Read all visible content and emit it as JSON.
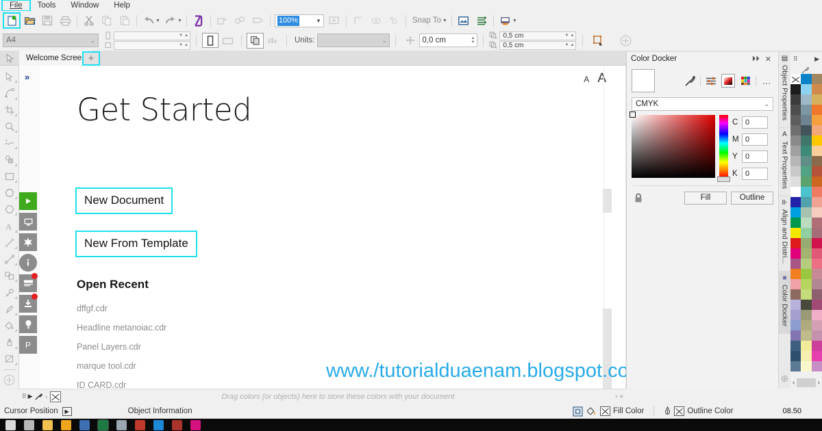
{
  "menubar": {
    "items": [
      {
        "label": "File",
        "selected": true
      },
      {
        "label": "Tools",
        "selected": false
      },
      {
        "label": "Window",
        "selected": false
      },
      {
        "label": "Help",
        "selected": false
      }
    ]
  },
  "toolbar": {
    "new_icon": "new-document-icon",
    "open_icon": "open-folder-icon",
    "save_icon": "save-icon",
    "print_icon": "print-icon",
    "cut_icon": "scissors-icon",
    "copy_icon": "copy-icon",
    "paste_icon": "paste-icon",
    "undo_icon": "undo-icon",
    "redo_icon": "redo-icon",
    "import_icon": "import-icon",
    "export_icon": "export-icon",
    "publish_pdf_icon": "publish-pdf-icon",
    "zoom_value": "100%",
    "fullscreen_icon": "full-screen-preview-icon",
    "guides_icon": "guides-icon",
    "show_hide_icon": "show-hide-icon",
    "snap_label": "Snap To",
    "options_icon": "options-icon",
    "object_manager_icon": "object-manager-icon",
    "launch_icon": "application-launcher-icon"
  },
  "propertybar": {
    "paper_size": "A4",
    "page_width": "",
    "page_height": "",
    "portrait_icon": "portrait-orientation-icon",
    "landscape_icon": "landscape-orientation-icon",
    "all_pages_icon": "all-pages-icon",
    "current_page_icon": "current-page-icon",
    "units_label": "Units:",
    "units_value": "",
    "nudge_value": "0,0 cm",
    "duplicate_x": "0,5 cm",
    "duplicate_y": "0,5 cm",
    "bounding_icon": "bounding-box-icon",
    "add_icon": "add-icon"
  },
  "tabbar": {
    "document_tab": "Welcome Screen",
    "add_tab_label": "+",
    "pick_tool_icon": "pick-tool-icon"
  },
  "toolbox": {
    "tools": [
      "pick-tool-icon",
      "shape-tool-icon",
      "crop-tool-icon",
      "zoom-tool-icon",
      "freehand-tool-icon",
      "smart-fill-tool-icon",
      "rectangle-tool-icon",
      "ellipse-tool-icon",
      "polygon-tool-icon",
      "text-tool-icon",
      "dimension-tool-icon",
      "connector-tool-icon",
      "blend-tool-icon",
      "color-eyedropper-icon",
      "outline-tool-icon",
      "fill-tool-icon",
      "interactive-fill-icon",
      "transparency-tool-icon"
    ],
    "add_tool_icon": "add-tool-icon"
  },
  "welcome": {
    "expand_icon": "expand-chevron-icon",
    "font_small_label": "A",
    "font_large_label": "A",
    "heading": "Get Started",
    "new_document": "New Document",
    "new_from_template": "New From Template",
    "open_recent_heading": "Open Recent",
    "recent_files": [
      "dffgf.cdr",
      "Headline metanoiac.cdr",
      "Panel Layers.cdr",
      "marque tool.cdr",
      "ID CARD.cdr"
    ],
    "side_buttons": [
      {
        "name": "play-video-button",
        "icon": "play-icon",
        "color": "#3faa1b",
        "badge": false
      },
      {
        "name": "workspace-button",
        "icon": "monitor-icon",
        "color": "#8c8c8c",
        "badge": false
      },
      {
        "name": "whats-new-button",
        "icon": "star-icon",
        "color": "#8c8c8c",
        "badge": false
      },
      {
        "name": "info-button",
        "icon": "info-icon",
        "color": "#8c8c8c",
        "badge": false
      },
      {
        "name": "news-button",
        "icon": "news-icon",
        "color": "#8c8c8c",
        "badge": true
      },
      {
        "name": "updates-button",
        "icon": "download-icon",
        "color": "#8c8c8c",
        "badge": true
      },
      {
        "name": "tips-button",
        "icon": "balloon-icon",
        "color": "#8c8c8c",
        "badge": false
      },
      {
        "name": "plugins-button",
        "icon": "p-icon",
        "color": "#8c8c8c",
        "badge": false
      }
    ]
  },
  "watermark": {
    "text": "www./tutorialduaenam.blogspot.com",
    "color": "#29abe8"
  },
  "color_docker": {
    "title": "Color Docker",
    "collapse_icon": "collapse-icon",
    "close_icon": "close-icon",
    "current_color": "#ffffff",
    "eyedropper_icon": "eyedropper-icon",
    "sliders_icon": "color-sliders-icon",
    "viewers_icon": "color-viewers-icon",
    "palettes_icon": "color-palettes-icon",
    "more_icon": "more-options-icon",
    "color_model": "CMYK",
    "channels": [
      {
        "key": "C",
        "value": "0"
      },
      {
        "key": "M",
        "value": "0"
      },
      {
        "key": "Y",
        "value": "0"
      },
      {
        "key": "K",
        "value": "0"
      }
    ],
    "lock_icon": "lock-icon",
    "fill_button": "Fill",
    "outline_button": "Outline"
  },
  "docker_tabs": [
    {
      "label": "Object Properties",
      "icon": "object-properties-icon",
      "active": false
    },
    {
      "label": "Text Properties",
      "icon": "text-properties-icon",
      "active": false
    },
    {
      "label": "Align and Distri...",
      "icon": "align-distribute-icon",
      "active": false
    },
    {
      "label": "Color Docker",
      "icon": "color-docker-icon",
      "active": true
    }
  ],
  "palette": {
    "cursor_icon": "palette-cursor-icon",
    "eyedropper_icon": "palette-eyedropper-icon",
    "prev_label": "‹",
    "next_label": "›",
    "colors": [
      [
        "none",
        "#0b82c8",
        "#a08661"
      ],
      [
        "#1c1c1c",
        "#8bd3f0",
        "#cf8a4c"
      ],
      [
        "#3b3b3b",
        "#9fb8c8",
        "#d6b05c"
      ],
      [
        "#4d4d4d",
        "#7d96a3",
        "#f0762b"
      ],
      [
        "#5e5e5e",
        "#6f8490",
        "#f5a03c"
      ],
      [
        "#6f6f6f",
        "#44545c",
        "#f2a878"
      ],
      [
        "#8a8a8a",
        "#41766b",
        "#ffc800"
      ],
      [
        "#a0a0a0",
        "#3d8a78",
        "#fbcf9a"
      ],
      [
        "#b6b6b6",
        "#5f8f88",
        "#8a6a4a"
      ],
      [
        "#c9c9c9",
        "#52a384",
        "#b5533a"
      ],
      [
        "#dedede",
        "#5aa36e",
        "#cc6620"
      ],
      [
        "#ffffff",
        "#4cc2cf",
        "#ef7a62"
      ],
      [
        "#2222a8",
        "#4fa2ae",
        "#f0a392"
      ],
      [
        "#00a0e0",
        "#a8c2b2",
        "#f5ccbd"
      ],
      [
        "#00974e",
        "#bcdcc2",
        "#b06e77"
      ],
      [
        "#f5e800",
        "#8fcfa0",
        "#a66d76"
      ],
      [
        "#e01b1b",
        "#97ac72",
        "#d1134e"
      ],
      [
        "#e0007a",
        "#a2b470",
        "#e05a78"
      ],
      [
        "#a95686",
        "#b6cc7e",
        "#ec6f85"
      ],
      [
        "#ef7f20",
        "#9bc63f",
        "#c78a95"
      ],
      [
        "#f0a0a8",
        "#b6d45e",
        "#b28793"
      ],
      [
        "#8c6a5e",
        "#c6dc7c",
        "#8e5f6e"
      ],
      [
        "#b6b2dc",
        "#4a4a3c",
        "#a04a74"
      ],
      [
        "#a3a0cf",
        "#9a9a76",
        "#f0aec9"
      ],
      [
        "#8b9ece",
        "#b0ab7e",
        "#d3a0b6"
      ],
      [
        "#8176b0",
        "#c0bb8a",
        "#c592ae"
      ],
      [
        "#3e5f80",
        "#f0ec9a",
        "#cc3f9a"
      ],
      [
        "#2e4f6e",
        "#f5f0b0",
        "#e53fae"
      ],
      [
        "#5d7a94",
        "#fbf7cc",
        "#c78ec6"
      ]
    ]
  },
  "colorstrip": {
    "hint": "Drag colors (or objects) here to store these colors with your document",
    "nav_next": "›",
    "nav_more": "»"
  },
  "statusbar": {
    "cursor_position": "Cursor Position",
    "object_information": "Object Information",
    "fill_color_label": "Fill Color",
    "outline_color_label": "Outline Color",
    "document_palette_icon": "document-palette-icon",
    "fill_icon": "paint-bucket-icon",
    "outline_icon": "pen-nib-icon",
    "expand_icon": "expand-arrow-icon",
    "clock": "08.50"
  },
  "taskbar": {
    "icons": [
      {
        "name": "taskview-icon",
        "color": "#d9d9d9"
      },
      {
        "name": "search-icon",
        "color": "#b8b8b8"
      },
      {
        "name": "explorer-icon",
        "color": "#f2c14e"
      },
      {
        "name": "folder-icon",
        "color": "#f0a51e"
      },
      {
        "name": "app-blue-icon",
        "color": "#3e6fb5"
      },
      {
        "name": "excel-icon",
        "color": "#1d7a43"
      },
      {
        "name": "app-gray-icon",
        "color": "#9aa6b0"
      },
      {
        "name": "app-red-icon",
        "color": "#c0392b"
      },
      {
        "name": "browser-icon",
        "color": "#1e88d8"
      },
      {
        "name": "app-darkred-icon",
        "color": "#a8342b"
      },
      {
        "name": "app-magenta-icon",
        "color": "#d6127f"
      }
    ]
  }
}
